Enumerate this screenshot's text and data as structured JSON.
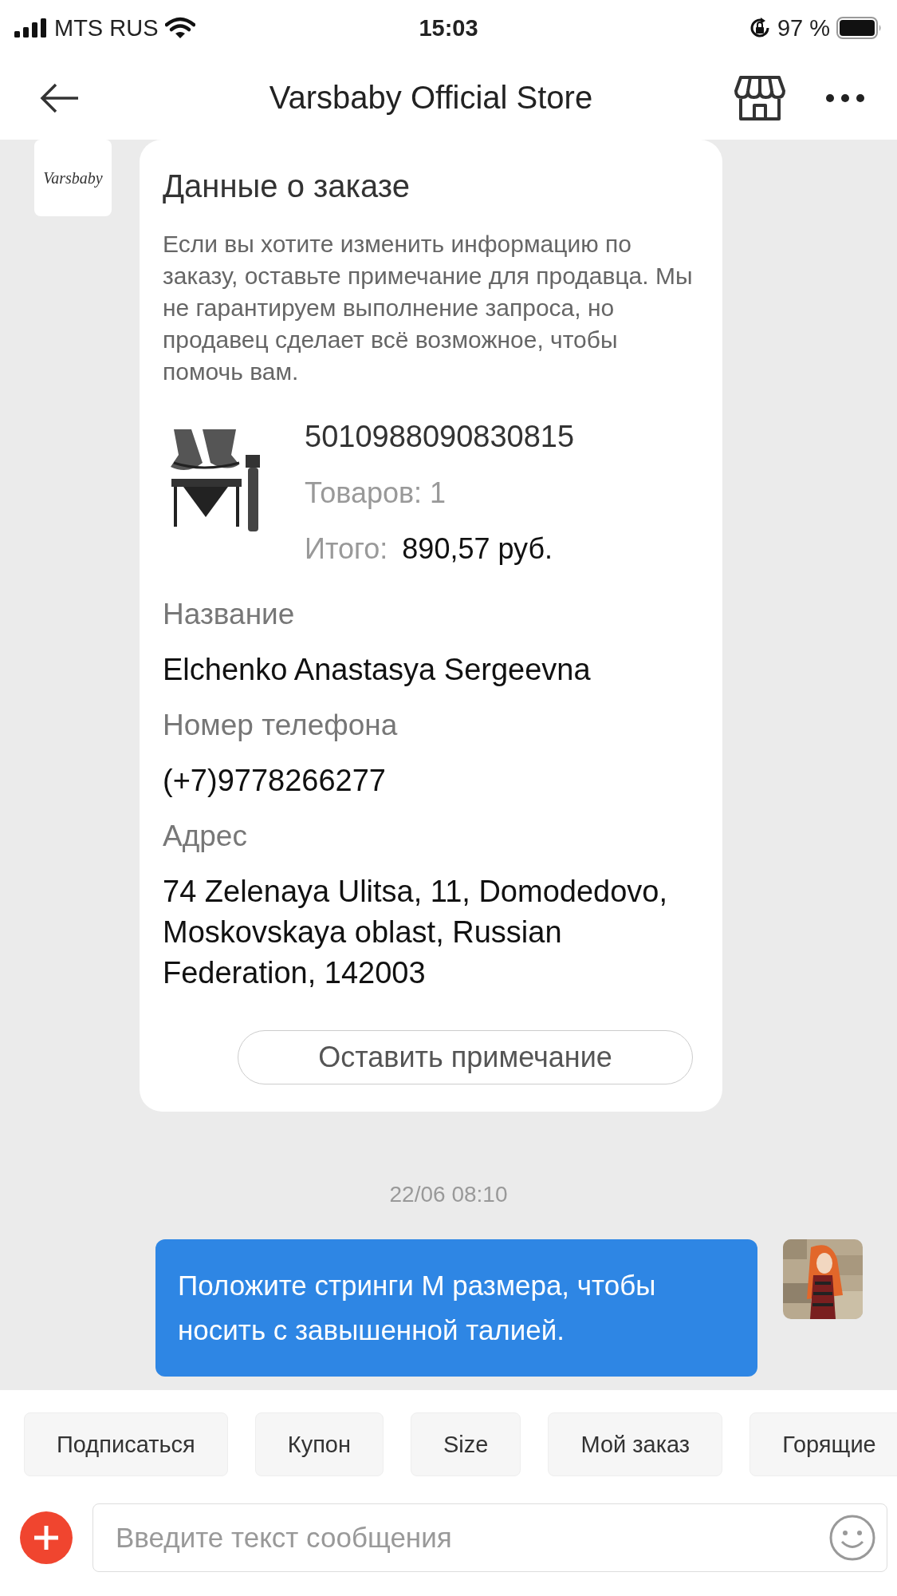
{
  "status_bar": {
    "carrier": "MTS RUS",
    "time": "15:03",
    "battery": "97 %"
  },
  "header": {
    "title": "Varsbaby Official Store"
  },
  "messages": [
    {
      "kind": "order_card",
      "sender_logo": "Varsbaby",
      "title": "Данные о заказе",
      "notice": "Если вы хотите изменить информацию по заказу, оставьте примечание для продавца. Мы не гарантируем выполнение запроса, но продавец сделает всё возможное, чтобы помочь вам.",
      "order": {
        "number": "5010988090830815",
        "items": "Товаров: 1",
        "total_label": "Итого:",
        "total": "890,57 руб."
      },
      "fields": [
        {
          "label": "Название",
          "value": "Elchenko Anastasya Sergeevna"
        },
        {
          "label": "Номер телефона",
          "value": "(+7)9778266277"
        },
        {
          "label": "Адрес",
          "value": "74 Zelenaya Ulitsa, 11, Domodedovo, Moskovskaya oblast, Russian Federation, 142003"
        }
      ],
      "button": "Оставить примечание"
    },
    {
      "kind": "timestamp",
      "text": "22/06 08:10"
    },
    {
      "kind": "outgoing",
      "text": "Положите стринги M размера, чтобы носить с завышенной талией."
    }
  ],
  "quick_replies": [
    "Подписаться",
    "Купон",
    "Size",
    "Мой заказ",
    "Горящие"
  ],
  "composer": {
    "placeholder": "Введите текст сообщения"
  }
}
